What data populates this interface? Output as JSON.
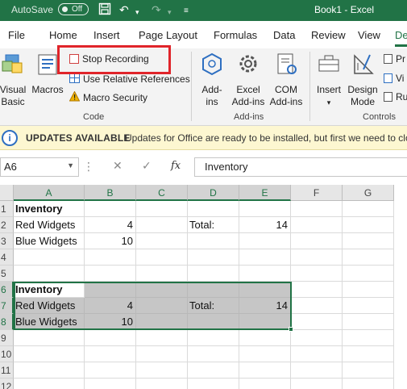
{
  "titlebar": {
    "autosave_label": "AutoSave",
    "autosave_state": "Off",
    "document_title": "Book1  -  Excel"
  },
  "tabs": [
    "File",
    "Home",
    "Insert",
    "Page Layout",
    "Formulas",
    "Data",
    "Review",
    "View",
    "De"
  ],
  "ribbon": {
    "code": {
      "visual_basic": [
        "Visual",
        "Basic"
      ],
      "macros": "Macros",
      "stop_recording": "Stop Recording",
      "relative_refs": "Use Relative References",
      "macro_security": "Macro Security",
      "group_name": "Code"
    },
    "addins": {
      "addins": [
        "Add-",
        "ins"
      ],
      "excel_addins": [
        "Excel",
        "Add-ins"
      ],
      "com_addins": [
        "COM",
        "Add-ins"
      ],
      "group_name": "Add-ins"
    },
    "controls": {
      "insert": "Insert",
      "design_mode": [
        "Design",
        "Mode"
      ],
      "pr": "Pr",
      "vi": "Vi",
      "ru": "Ru",
      "group_name": "Controls"
    }
  },
  "notice": {
    "title": "UPDATES AVAILABLE",
    "message": "Updates for Office are ready to be installed, but first we need to clo"
  },
  "formula_bar": {
    "name_box": "A6",
    "content": "Inventory"
  },
  "grid": {
    "columns": [
      "A",
      "B",
      "C",
      "D",
      "E",
      "F",
      "G"
    ],
    "rows": [
      "1",
      "2",
      "3",
      "4",
      "5",
      "6",
      "7",
      "8",
      "9",
      "10",
      "11",
      "12"
    ],
    "cells": {
      "A1": "Inventory",
      "A2": "Red Widgets",
      "B2": "4",
      "D2": "Total:",
      "E2": "14",
      "A3": "Blue Widgets",
      "B3": "10",
      "A6": "Inventory",
      "A7": "Red Widgets",
      "B7": "4",
      "D7": "Total:",
      "E7": "14",
      "A8": "Blue Widgets",
      "B8": "10"
    }
  },
  "colors": {
    "excel_green": "#217346",
    "highlight_red": "#e0242a",
    "notice_bg": "#fdf7d1",
    "selection_fill": "#c6c6c6"
  }
}
